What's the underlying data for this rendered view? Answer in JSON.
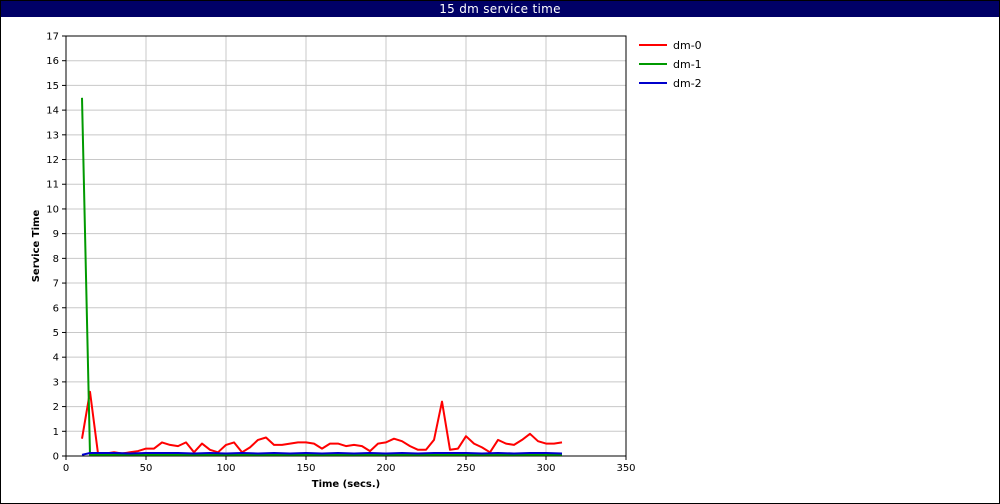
{
  "window": {
    "title": "15 dm service time"
  },
  "chart_data": {
    "type": "line",
    "title": "15 dm service time",
    "xlabel": "Time (secs.)",
    "ylabel": "Service Time",
    "xlim": [
      0,
      350
    ],
    "ylim": [
      0,
      17
    ],
    "xticks": [
      0,
      50,
      100,
      150,
      200,
      250,
      300,
      350
    ],
    "yticks": [
      0,
      1,
      2,
      3,
      4,
      5,
      6,
      7,
      8,
      9,
      10,
      11,
      12,
      13,
      14,
      15,
      16,
      17
    ],
    "grid": true,
    "legend_position": "right",
    "series": [
      {
        "name": "dm-0",
        "color": "#ff0000",
        "x": [
          10,
          15,
          20,
          25,
          30,
          35,
          40,
          45,
          50,
          55,
          60,
          65,
          70,
          75,
          80,
          85,
          90,
          95,
          100,
          105,
          110,
          115,
          120,
          125,
          130,
          135,
          140,
          145,
          150,
          155,
          160,
          165,
          170,
          175,
          180,
          185,
          190,
          195,
          200,
          205,
          210,
          215,
          220,
          225,
          230,
          235,
          240,
          245,
          250,
          255,
          260,
          265,
          270,
          275,
          280,
          285,
          290,
          295,
          300,
          305,
          310
        ],
        "y": [
          0.7,
          2.6,
          0.1,
          0.1,
          0.15,
          0.1,
          0.15,
          0.2,
          0.3,
          0.3,
          0.55,
          0.45,
          0.4,
          0.55,
          0.15,
          0.5,
          0.25,
          0.15,
          0.45,
          0.55,
          0.15,
          0.35,
          0.65,
          0.75,
          0.45,
          0.45,
          0.5,
          0.55,
          0.55,
          0.5,
          0.3,
          0.5,
          0.5,
          0.4,
          0.45,
          0.4,
          0.2,
          0.5,
          0.55,
          0.7,
          0.6,
          0.4,
          0.25,
          0.25,
          0.65,
          2.2,
          0.25,
          0.3,
          0.8,
          0.5,
          0.35,
          0.15,
          0.65,
          0.5,
          0.45,
          0.65,
          0.9,
          0.6,
          0.5,
          0.5,
          0.55
        ]
      },
      {
        "name": "dm-1",
        "color": "#009900",
        "x": [
          10,
          15,
          20,
          25,
          30,
          35,
          40,
          45,
          50,
          60,
          70,
          80,
          90,
          100,
          120,
          140,
          160,
          180,
          200,
          220,
          240,
          260,
          280,
          300,
          310
        ],
        "y": [
          14.5,
          0.05,
          0.05,
          0.05,
          0.05,
          0.05,
          0.05,
          0.05,
          0.05,
          0.05,
          0.05,
          0.05,
          0.05,
          0.05,
          0.05,
          0.05,
          0.05,
          0.05,
          0.05,
          0.05,
          0.05,
          0.05,
          0.05,
          0.05,
          0.05
        ]
      },
      {
        "name": "dm-2",
        "color": "#0000cc",
        "x": [
          10,
          15,
          20,
          30,
          40,
          50,
          60,
          70,
          80,
          90,
          100,
          110,
          120,
          130,
          140,
          150,
          160,
          170,
          180,
          190,
          200,
          210,
          220,
          230,
          240,
          250,
          260,
          270,
          280,
          290,
          300,
          310
        ],
        "y": [
          0.05,
          0.12,
          0.12,
          0.12,
          0.1,
          0.12,
          0.12,
          0.12,
          0.1,
          0.12,
          0.1,
          0.12,
          0.1,
          0.12,
          0.1,
          0.12,
          0.1,
          0.12,
          0.1,
          0.12,
          0.1,
          0.12,
          0.1,
          0.12,
          0.12,
          0.12,
          0.1,
          0.12,
          0.1,
          0.12,
          0.12,
          0.1
        ]
      }
    ]
  }
}
